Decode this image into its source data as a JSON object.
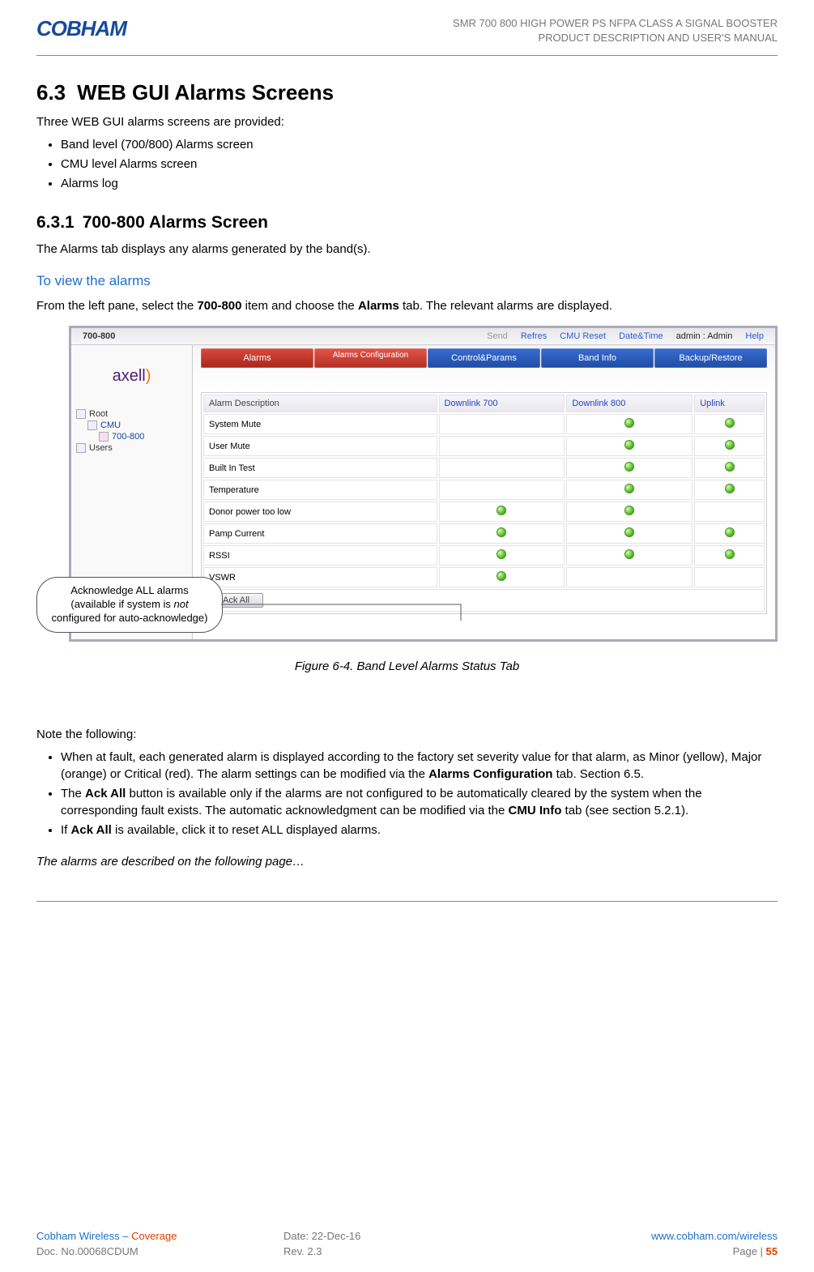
{
  "doc": {
    "logo_text": "COBHAM",
    "header_line1": "SMR 700 800 HIGH POWER PS NFPA CLASS A SIGNAL BOOSTER",
    "header_line2": "PRODUCT DESCRIPTION AND USER'S MANUAL",
    "section_num": "6.3",
    "section_title": "WEB GUI Alarms Screens",
    "intro_line": "Three WEB GUI alarms screens are provided:",
    "intro_bullets": [
      "Band level (700/800) Alarms screen",
      "CMU level Alarms screen",
      "Alarms log"
    ],
    "sub_num": "6.3.1",
    "sub_title": "700-800 Alarms Screen",
    "sub_intro": "The Alarms tab displays any alarms generated by the band(s).",
    "blue_heading": "To view the alarms",
    "instruction_pre": "From the left pane, select the ",
    "instruction_bold1": "700-800",
    "instruction_mid": " item and choose the ",
    "instruction_bold2": "Alarms",
    "instruction_post": " tab. The relevant alarms are displayed.",
    "callout_l1": "Acknowledge ALL alarms",
    "callout_l2a": "(available if system is ",
    "callout_l2_em": "not",
    "callout_l3": " configured for auto-acknowledge)",
    "figure_caption": "Figure 6-4. Band Level Alarms Status Tab",
    "note_heading": "Note the following:",
    "note_bullets": [
      {
        "pre": "When at fault, each generated alarm is displayed according to the factory set severity value for that alarm, as Minor (yellow), Major (orange) or Critical (red). The alarm settings can be modified via the ",
        "bold": "Alarms Configuration",
        "post": " tab. Section 6.5."
      },
      {
        "pre": "The ",
        "bold": "Ack All",
        "post": " button is available only if the alarms are not configured to be automatically cleared by the system when the corresponding fault exists. The automatic acknowledgment can be modified via the ",
        "bold2": "CMU Info",
        "post2": " tab (see section 5.2.1)."
      },
      {
        "pre": "If ",
        "bold": "Ack All",
        "post": " is available, click it to reset ALL displayed alarms."
      }
    ],
    "continue_note": "The alarms are described on the following page…",
    "footer": {
      "left1a": "Cobham Wireless",
      "left1b": " – ",
      "left1c": "Coverage",
      "center1": "Date: 22-Dec-16",
      "right1": "www.cobham.com/wireless",
      "left2": "Doc. No.00068CDUM",
      "center2": "Rev. 2.3",
      "right2_pre": "Page | ",
      "right2_num": "55"
    }
  },
  "app": {
    "topbar": {
      "title": "700-800",
      "send": "Send",
      "refresh": "Refres",
      "cmu_reset": "CMU Reset",
      "datetime": "Date&Time",
      "admin": "admin : Admin",
      "help": "Help"
    },
    "tabs": [
      {
        "label": "Alarms",
        "style": "red"
      },
      {
        "label": "Alarms Configuration",
        "style": "red2 small"
      },
      {
        "label": "Control&Params",
        "style": "blue"
      },
      {
        "label": "Band Info",
        "style": "blue"
      },
      {
        "label": "Backup/Restore",
        "style": "blue"
      }
    ],
    "tree": {
      "root": "Root",
      "cmu": "CMU",
      "band": "700-800",
      "users": "Users"
    },
    "table": {
      "headers": [
        "Alarm Description",
        "Downlink 700",
        "Downlink 800",
        "Uplink"
      ],
      "rows": [
        {
          "name": "System Mute",
          "dl700": false,
          "dl800": true,
          "ul": true
        },
        {
          "name": "User Mute",
          "dl700": false,
          "dl800": true,
          "ul": true
        },
        {
          "name": "Built In Test",
          "dl700": false,
          "dl800": true,
          "ul": true
        },
        {
          "name": "Temperature",
          "dl700": false,
          "dl800": true,
          "ul": true
        },
        {
          "name": "Donor power too low",
          "dl700": true,
          "dl800": true,
          "ul": false
        },
        {
          "name": "Pamp Current",
          "dl700": true,
          "dl800": true,
          "ul": true
        },
        {
          "name": "RSSI",
          "dl700": true,
          "dl800": true,
          "ul": true
        },
        {
          "name": "VSWR",
          "dl700": true,
          "dl800": false,
          "ul": false
        }
      ],
      "ack_label": "Ack All"
    }
  }
}
